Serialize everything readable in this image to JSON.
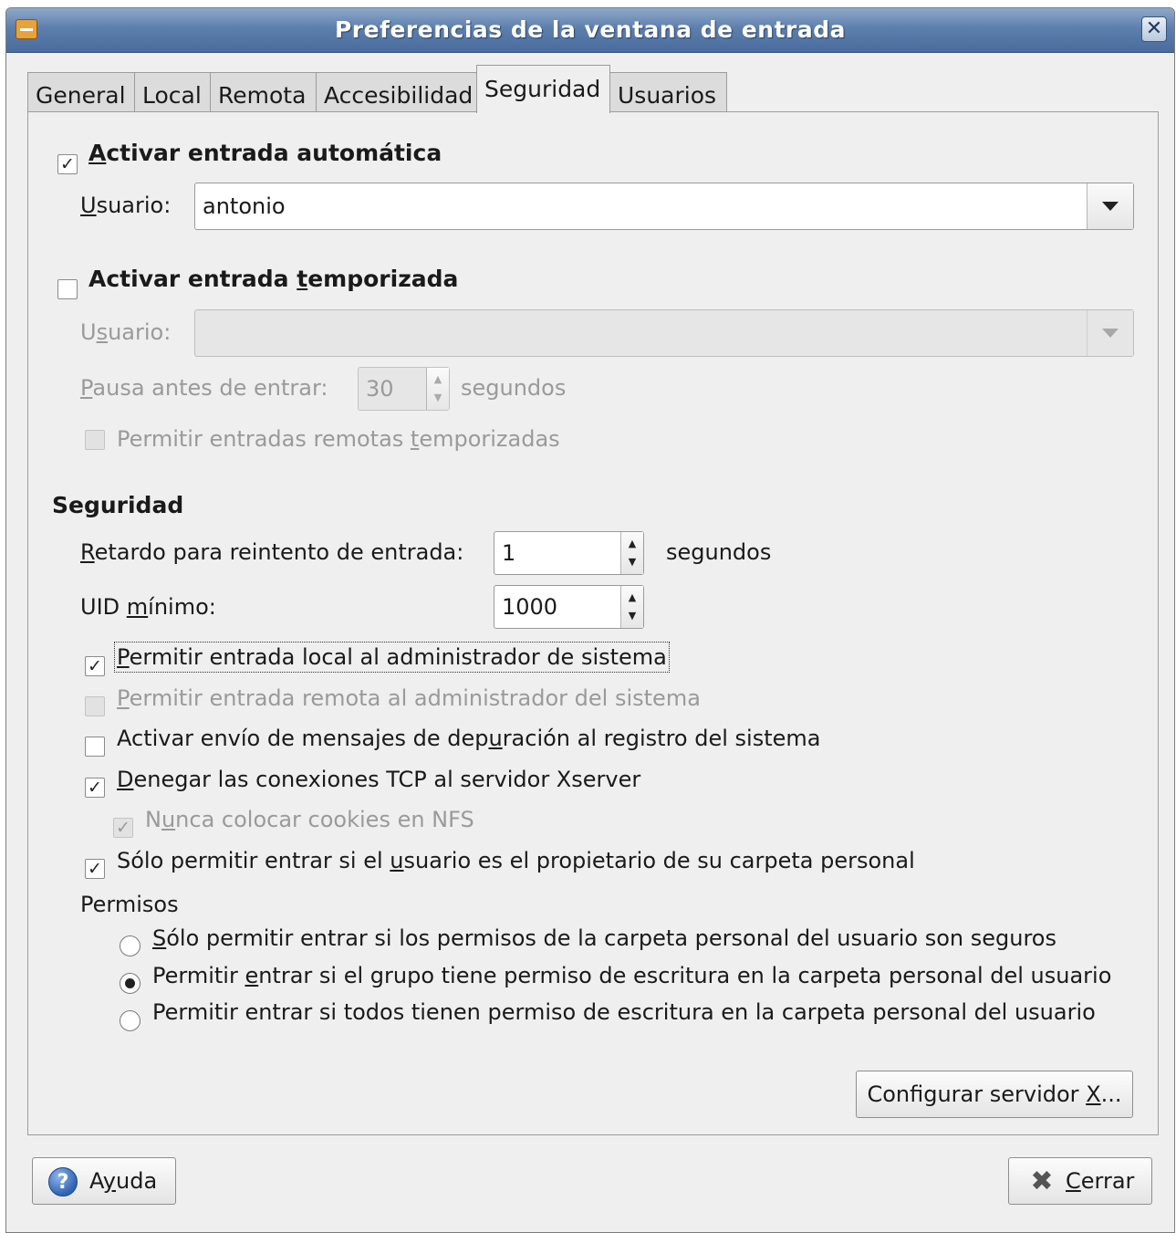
{
  "window": {
    "title": "Preferencias de la ventana de entrada",
    "close_glyph": "✕"
  },
  "tabs": [
    {
      "label": "General"
    },
    {
      "label": "Local"
    },
    {
      "label": "Remota"
    },
    {
      "label": "Accesibilidad"
    },
    {
      "label": "Seguridad",
      "active": true
    },
    {
      "label": "Usuarios"
    }
  ],
  "autologin": {
    "label_prefix": "",
    "label_u": "A",
    "label_suffix": "ctivar entrada automática",
    "checked": true,
    "user_label_u": "U",
    "user_label_rest": "suario:",
    "user_value": "antonio"
  },
  "timed": {
    "label_prefix": "Activar entrada ",
    "label_u": "t",
    "label_suffix": "emporizada",
    "checked": false,
    "user_label_pre": "U",
    "user_label_u": "s",
    "user_label_rest": "uario:",
    "user_value": "",
    "pause_label_u": "P",
    "pause_label_rest": "ausa antes de entrar:",
    "pause_value": "30",
    "pause_unit": "segundos",
    "remote_prefix": "Permitir entradas remotas ",
    "remote_u": "t",
    "remote_suffix": "emporizadas"
  },
  "security": {
    "heading": "Seguridad",
    "retry_label_u": "R",
    "retry_label_rest": "etardo para reintento de entrada:",
    "retry_value": "1",
    "retry_unit": "segundos",
    "uid_label_pre": "UID ",
    "uid_label_u": "m",
    "uid_label_rest": "ínimo:",
    "uid_value": "1000",
    "checks": {
      "local_admin": {
        "u": "P",
        "rest": "ermitir entrada local al administrador de sistema",
        "checked": true
      },
      "remote_admin": {
        "u": "P",
        "rest": "ermitir entrada remota al administrador del sistema",
        "checked": false
      },
      "debug_pre": "Activar envío de mensajes de dep",
      "debug_u": "u",
      "debug_rest": "ración al registro del sistema",
      "tcp": {
        "u": "D",
        "rest": "enegar las conexiones TCP al servidor Xserver",
        "checked": true
      },
      "nfs_pre": "N",
      "nfs_u": "u",
      "nfs_rest": "nca colocar cookies en NFS",
      "owner_pre": "Sólo permitir entrar si el ",
      "owner_u": "u",
      "owner_rest": "suario es el propietario de su carpeta personal"
    },
    "permisos_label": "Permisos",
    "radios": {
      "r1_u": "S",
      "r1_rest": "ólo permitir entrar si los permisos de la carpeta personal del usuario son seguros",
      "r2_pre": "Permitir ",
      "r2_u": "e",
      "r2_rest": "ntrar si el grupo tiene permiso de escritura en la carpeta personal del usuario",
      "r3": "Permitir entrar si todos tienen permiso de escritura en la carpeta personal del usuario"
    },
    "configure_pre": "Configurar servidor ",
    "configure_u": "X",
    "configure_rest": "..."
  },
  "footer": {
    "help_pre": "A",
    "help_u": "y",
    "help_rest": "uda",
    "close_u": "C",
    "close_rest": "errar"
  },
  "icons": {
    "help": "?",
    "close": "✖",
    "check": "✓"
  }
}
